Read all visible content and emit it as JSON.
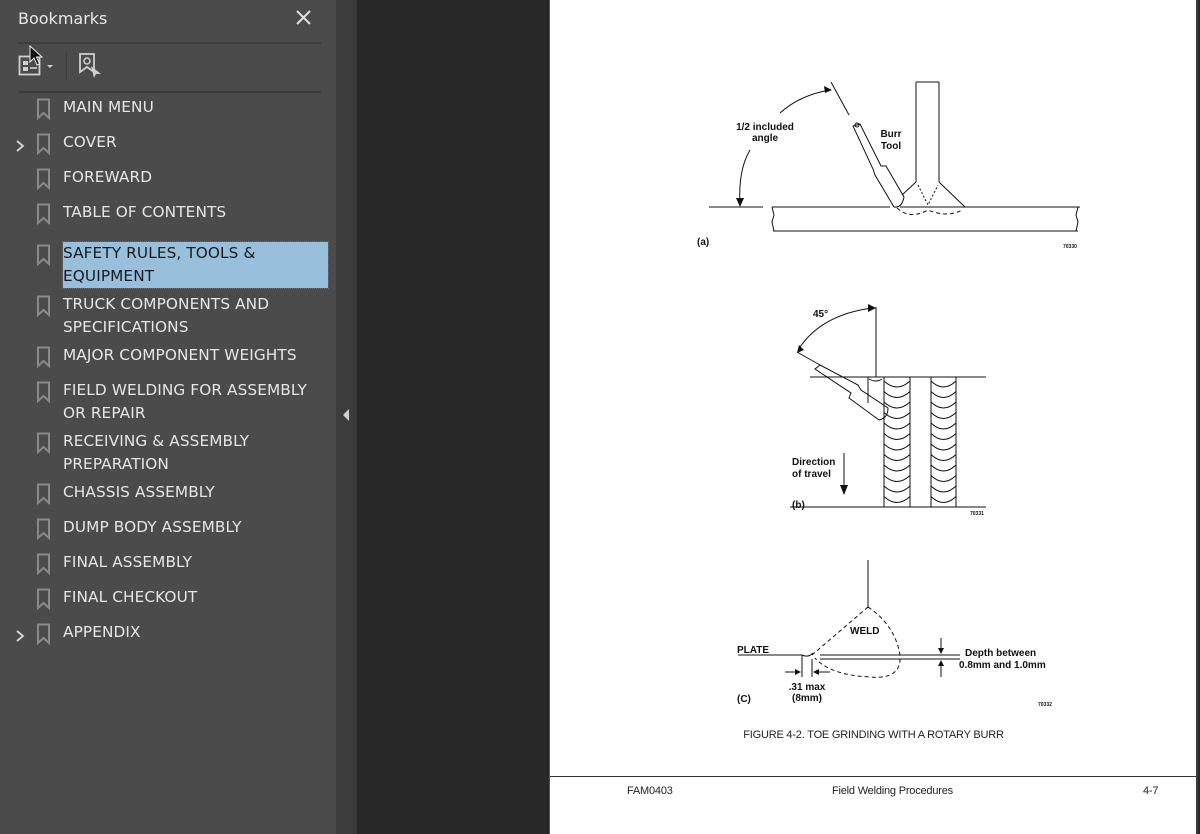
{
  "bookmarks_panel": {
    "title": "Bookmarks",
    "close_icon": "close-icon",
    "toolbar": {
      "options_icon": "bookmark-options-icon",
      "find_icon": "find-current-bookmark-icon"
    },
    "items": [
      {
        "label": "MAIN MENU",
        "expandable": false,
        "selected": false
      },
      {
        "label": "COVER",
        "expandable": true,
        "selected": false
      },
      {
        "label": "FOREWARD",
        "expandable": false,
        "selected": false
      },
      {
        "label": "TABLE OF CONTENTS",
        "expandable": false,
        "selected": false
      },
      {
        "label": "SAFETY RULES, TOOLS & EQUIPMENT",
        "expandable": false,
        "selected": true
      },
      {
        "label": "TRUCK COMPONENTS AND SPECIFICATIONS",
        "expandable": false,
        "selected": false
      },
      {
        "label": "MAJOR COMPONENT WEIGHTS",
        "expandable": false,
        "selected": false
      },
      {
        "label": "FIELD WELDING FOR ASSEMBLY OR REPAIR",
        "expandable": false,
        "selected": false
      },
      {
        "label": "RECEIVING & ASSEMBLY PREPARATION",
        "expandable": false,
        "selected": false
      },
      {
        "label": "CHASSIS ASSEMBLY",
        "expandable": false,
        "selected": false
      },
      {
        "label": "DUMP BODY ASSEMBLY",
        "expandable": false,
        "selected": false
      },
      {
        "label": "FINAL ASSEMBLY",
        "expandable": false,
        "selected": false
      },
      {
        "label": "FINAL CHECKOUT",
        "expandable": false,
        "selected": false
      },
      {
        "label": "APPENDIX",
        "expandable": true,
        "selected": false
      }
    ],
    "collapse_icon": "collapse-panel-icon"
  },
  "document": {
    "figure_a": {
      "label_angle": [
        "1/2 included",
        "angle"
      ],
      "label_tool": [
        "Burr",
        "Tool"
      ],
      "panel": "(a)",
      "code": "70330"
    },
    "figure_b": {
      "angle": "45°",
      "label_direction": [
        "Direction",
        "of travel"
      ],
      "panel": "(b)",
      "code": "70331"
    },
    "figure_c": {
      "weld": "WELD",
      "plate": "PLATE",
      "depth": [
        "Depth between",
        "0.8mm and 1.0mm"
      ],
      "max": [
        ".31 max",
        "(8mm)"
      ],
      "panel": "(C)",
      "code": "70332"
    },
    "caption": "FIGURE 4-2. TOE GRINDING WITH A ROTARY BURR",
    "footer": {
      "left": "FAM0403",
      "center": "Field Welding Procedures",
      "right": "4-7"
    }
  }
}
